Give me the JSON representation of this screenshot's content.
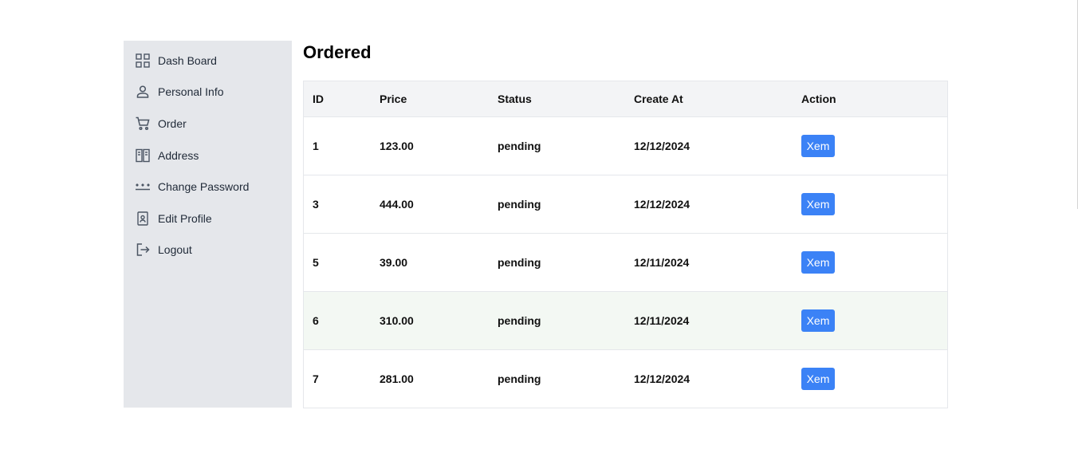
{
  "sidebar": {
    "items": [
      {
        "label": "Dash Board",
        "icon": "grid-icon"
      },
      {
        "label": "Personal Info",
        "icon": "user-icon"
      },
      {
        "label": "Order",
        "icon": "cart-icon"
      },
      {
        "label": "Address",
        "icon": "address-book-icon"
      },
      {
        "label": "Change Password",
        "icon": "password-icon"
      },
      {
        "label": "Edit Profile",
        "icon": "contact-card-icon"
      },
      {
        "label": "Logout",
        "icon": "logout-icon"
      }
    ]
  },
  "main": {
    "title": "Ordered",
    "table": {
      "headers": {
        "id": "ID",
        "price": "Price",
        "status": "Status",
        "created": "Create At",
        "action": "Action"
      },
      "rows": [
        {
          "id": "1",
          "price": "123.00",
          "status": "pending",
          "created": "12/12/2024",
          "action": "Xem"
        },
        {
          "id": "3",
          "price": "444.00",
          "status": "pending",
          "created": "12/12/2024",
          "action": "Xem"
        },
        {
          "id": "5",
          "price": "39.00",
          "status": "pending",
          "created": "12/11/2024",
          "action": "Xem"
        },
        {
          "id": "6",
          "price": "310.00",
          "status": "pending",
          "created": "12/11/2024",
          "action": "Xem"
        },
        {
          "id": "7",
          "price": "281.00",
          "status": "pending",
          "created": "12/12/2024",
          "action": "Xem"
        }
      ]
    }
  },
  "colors": {
    "sidebar_bg": "#e5e7eb",
    "header_bg": "#f3f4f6",
    "button": "#3b82f6",
    "hover_row": "#f3f8f3"
  }
}
